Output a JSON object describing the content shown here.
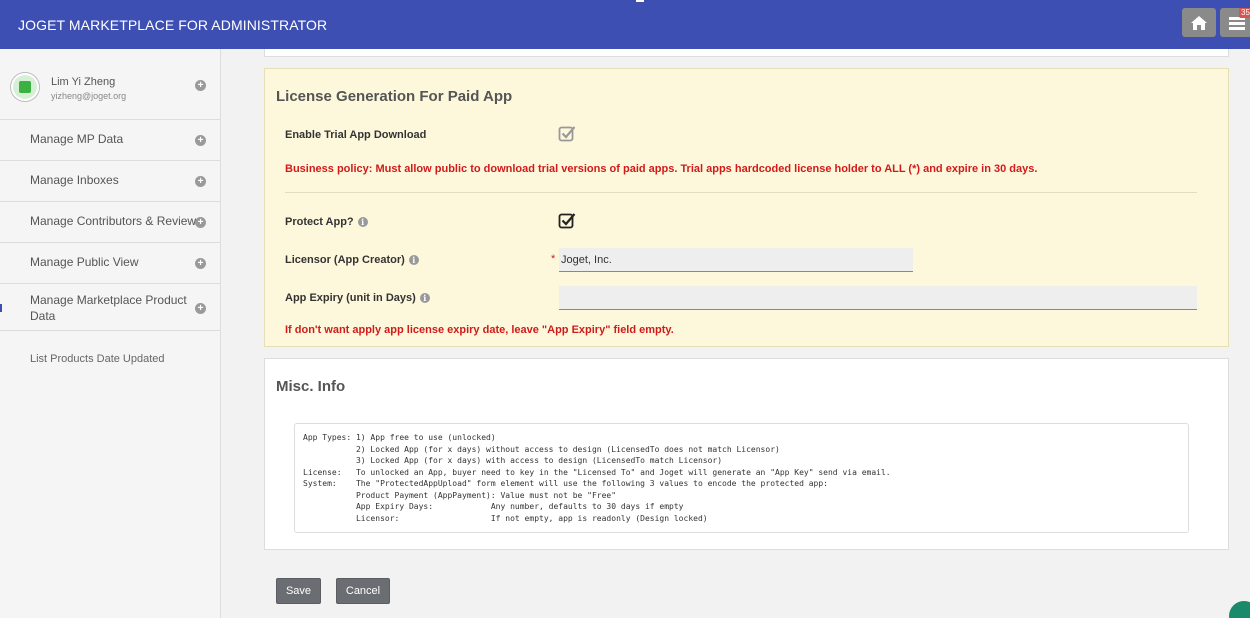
{
  "header": {
    "title": "JOGET MARKETPLACE FOR ADMINISTRATOR",
    "badge": "35",
    "accent": "#3e4fb3"
  },
  "sidebar": {
    "user": {
      "name": "Lim Yi Zheng",
      "email": "yizheng@joget.org"
    },
    "items": [
      {
        "label": "Manage MP Data"
      },
      {
        "label": "Manage Inboxes"
      },
      {
        "label": "Manage Contributors & Reviews"
      },
      {
        "label": "Manage Public View"
      },
      {
        "label": "Manage Marketplace Product Data"
      }
    ],
    "sub_item": "List Products Date Updated"
  },
  "license_panel": {
    "title": "License Generation For Paid App",
    "trial_label": "Enable Trial App Download",
    "trial_checked": true,
    "policy_text": "Business policy: Must allow public to download trial versions of paid apps. Trial apps hardcoded license holder to ALL (*) and expire in 30 days.",
    "protect_label": "Protect App?",
    "protect_checked": true,
    "licensor_label": "Licensor (App Creator)",
    "licensor_required": "*",
    "licensor_value": "Joget, Inc.",
    "expiry_label": "App Expiry (unit in Days)",
    "expiry_value": "",
    "expiry_note": "If don't want apply app license expiry date, leave \"App Expiry\" field empty."
  },
  "misc_panel": {
    "title": "Misc. Info",
    "text": "App Types: 1) App free to use (unlocked)\n           2) Locked App (for x days) without access to design (LicensedTo does not match Licensor)\n           3) Locked App (for x days) with access to design (LicensedTo match Licensor)\nLicense:   To unlocked an App, buyer need to key in the \"Licensed To\" and Joget will generate an \"App Key\" send via email.\nSystem:    The \"ProtectedAppUpload\" form element will use the following 3 values to encode the protected app:\n           Product Payment (AppPayment): Value must not be \"Free\"\n           App Expiry Days:            Any number, defaults to 30 days if empty\n           Licensor:                   If not empty, app is readonly (Design locked)"
  },
  "actions": {
    "save_label": "Save",
    "cancel_label": "Cancel"
  }
}
